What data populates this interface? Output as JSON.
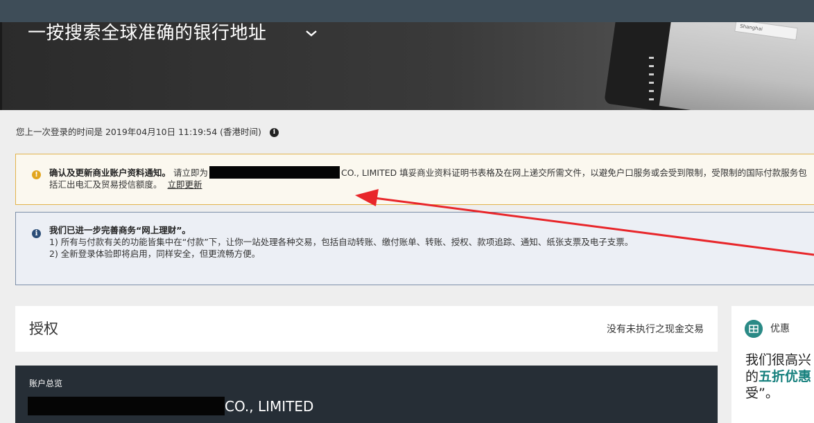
{
  "hero": {
    "title": "一按搜索全球准确的银行地址",
    "device_field_text": "Shanghai"
  },
  "last_login": {
    "text": "您上一次登录的时间是 2019年04月10日 11:19:54 (香港时间)"
  },
  "notice_warning": {
    "bold": "确认及更新商业账户资料通知。",
    "before_redact": "请立即为",
    "after_redact": "CO., LIMITED 填妥商业资料证明书表格及在网上递交所需文件，以避免户口服务或会受到限制，受限制的国际付款服务包括汇出电汇及贸易授信额度。",
    "link": "立即更新"
  },
  "notice_info": {
    "bold": "我们已进一步完善商务“网上理财”。",
    "line1": "1) 所有与付款有关的功能皆集中在“付款”下，让你一站处理各种交易，包括自动转账、缴付账单、转账、授权、款项追踪、通知、纸张支票及电子支票。",
    "line2": "2) 全新登录体验即将启用，同样安全，但更流畅方便。"
  },
  "authorization": {
    "title": "授权",
    "status": "没有未执行之现金交易"
  },
  "account_overview": {
    "label": "账户总览",
    "name_suffix": "CO., LIMITED"
  },
  "promo": {
    "title": "优惠",
    "text_before": "我们很高兴",
    "text_line2_prefix": "的",
    "highlight": "五折优惠",
    "text_line3": "受”。"
  },
  "colors": {
    "topbar": "#3e4d58",
    "warning_border": "#e2b34a",
    "info_icon": "#2b4d77",
    "promo_accent": "#16807d",
    "annotation_arrow": "#e8262a"
  }
}
